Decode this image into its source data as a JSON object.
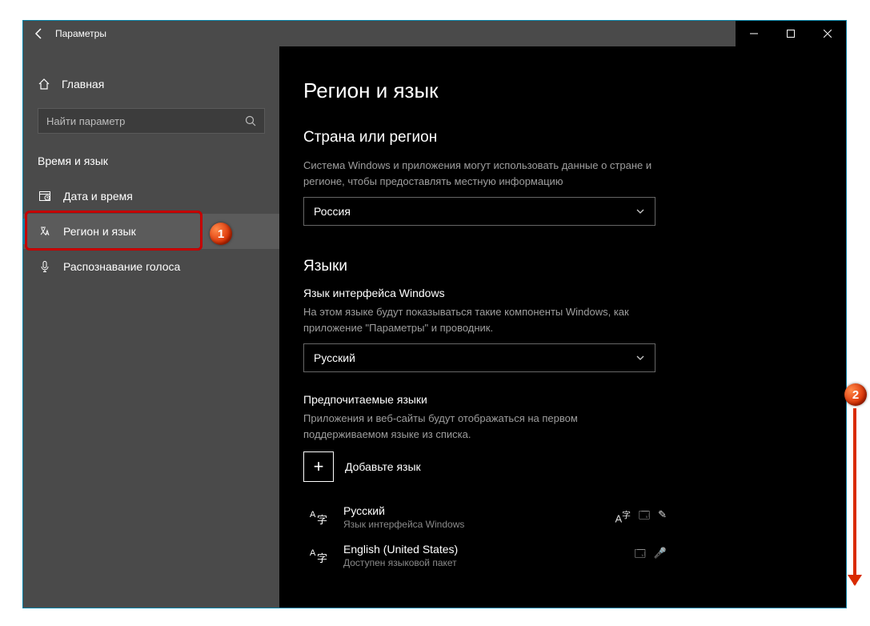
{
  "window": {
    "title": "Параметры"
  },
  "sidebar": {
    "home": "Главная",
    "search_placeholder": "Найти параметр",
    "section": "Время и язык",
    "items": [
      {
        "label": "Дата и время"
      },
      {
        "label": "Регион и язык"
      },
      {
        "label": "Распознавание голоса"
      }
    ]
  },
  "content": {
    "title": "Регион и язык",
    "region": {
      "heading": "Страна или регион",
      "desc": "Система Windows и приложения могут использовать данные о стране и регионе, чтобы предоставлять местную информацию",
      "selected": "Россия"
    },
    "languages": {
      "heading": "Языки",
      "interface_label": "Язык интерфейса Windows",
      "interface_desc": "На этом языке будут показываться такие компоненты Windows, как приложение \"Параметры\" и проводник.",
      "interface_selected": "Русский",
      "preferred_label": "Предпочитаемые языки",
      "preferred_desc": "Приложения и веб-сайты будут отображаться на первом поддерживаемом языке из списка.",
      "add_label": "Добавьте язык",
      "items": [
        {
          "name": "Русский",
          "sub": "Язык интерфейса Windows"
        },
        {
          "name": "English (United States)",
          "sub": "Доступен языковой пакет"
        }
      ]
    }
  },
  "markers": {
    "m1": "1",
    "m2": "2"
  }
}
